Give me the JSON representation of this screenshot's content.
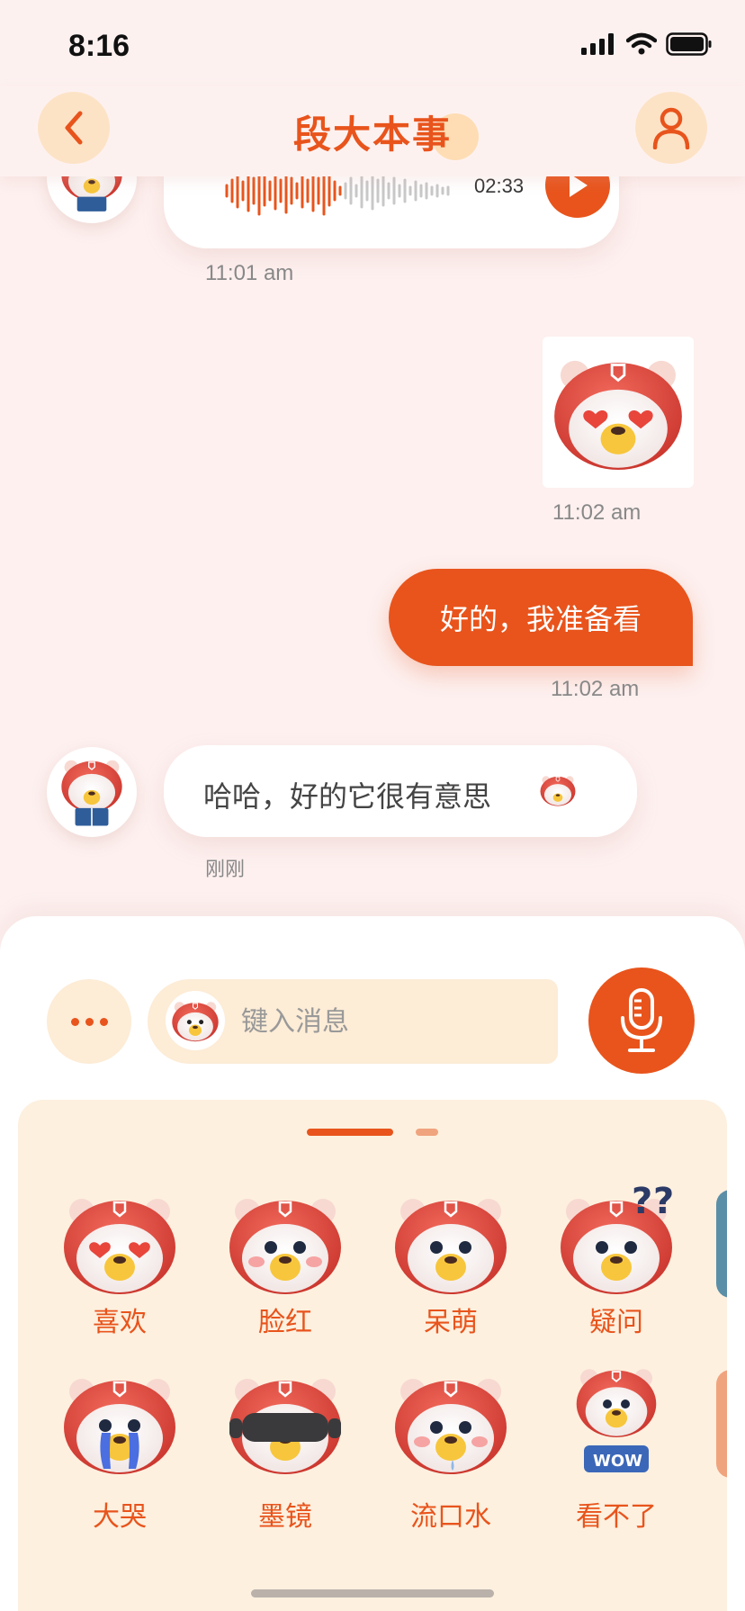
{
  "status_bar": {
    "time": "8:16"
  },
  "header": {
    "title": "段大本事"
  },
  "messages": {
    "voice": {
      "duration": "02:33",
      "time": "11:01 am"
    },
    "sticker": {
      "time": "11:02 am"
    },
    "outgoing_text": {
      "text": "好的，我准备看",
      "time": "11:02 am"
    },
    "incoming_text": {
      "text": "哈哈，好的它很有意思",
      "time": "刚刚"
    }
  },
  "composer": {
    "placeholder": "键入消息"
  },
  "sticker_panel": {
    "page_count": 2,
    "current_page": 1,
    "stickers": [
      {
        "label": "喜欢"
      },
      {
        "label": "脸红"
      },
      {
        "label": "呆萌"
      },
      {
        "label": "疑问"
      },
      {
        "label": "大哭"
      },
      {
        "label": "墨镜"
      },
      {
        "label": "流口水"
      },
      {
        "label": "看不了"
      }
    ]
  },
  "colors": {
    "accent": "#e8541c",
    "background": "#fdf0ef",
    "panel": "#fdf0df"
  }
}
